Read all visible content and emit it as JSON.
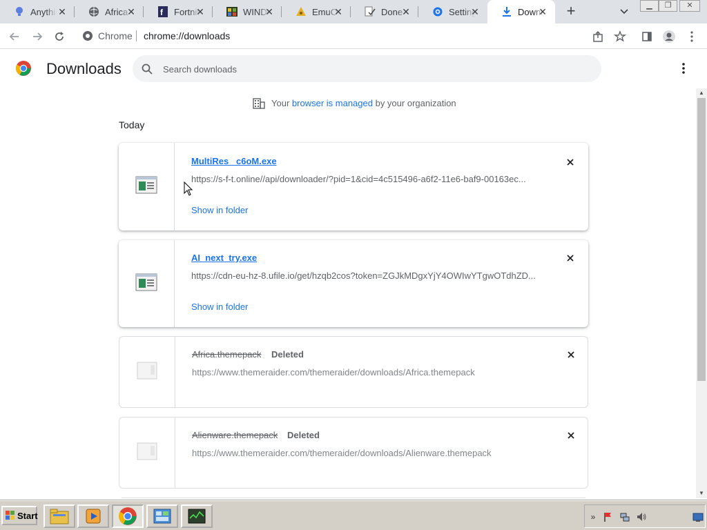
{
  "tabs": [
    {
      "title": "Anything",
      "icon": "bulb-icon",
      "active": false
    },
    {
      "title": "Africa",
      "icon": "globe-icon",
      "active": false
    },
    {
      "title": "Fortnite",
      "icon": "f-logo-icon",
      "active": false
    },
    {
      "title": "WINDOWS",
      "icon": "windows-logo-icon",
      "active": false
    },
    {
      "title": "EmuOS",
      "icon": "emu-icon",
      "active": false
    },
    {
      "title": "Done",
      "icon": "doc-check-icon",
      "active": false
    },
    {
      "title": "Settings",
      "icon": "gear-icon",
      "active": false
    },
    {
      "title": "Downloads",
      "icon": "download-icon",
      "active": true
    }
  ],
  "toolbar": {
    "site_label": "Chrome",
    "url": "chrome://downloads"
  },
  "header": {
    "title": "Downloads",
    "search_placeholder": "Search downloads"
  },
  "managed_notice": {
    "prefix": "Your",
    "link": "browser is managed",
    "suffix": "by your organization"
  },
  "section_label": "Today",
  "downloads": [
    {
      "filename": "MultiRes _c6oM.exe",
      "url": "https://s-f-t.online//api/downloader/?pid=1&cid=4c515496-a6f2-11e6-baf9-00163ec...",
      "action": "Show in folder",
      "status": "",
      "deleted": false
    },
    {
      "filename": "AI_next_try.exe",
      "url": "https://cdn-eu-hz-8.ufile.io/get/hzqb2cos?token=ZGJkMDgxYjY4OWIwYTgwOTdhZD...",
      "action": "Show in folder",
      "status": "",
      "deleted": false
    },
    {
      "filename": "Africa.themepack",
      "url": "https://www.themeraider.com/themeraider/downloads/Africa.themepack",
      "action": "",
      "status": "Deleted",
      "deleted": true
    },
    {
      "filename": "Alienware.themepack",
      "url": "https://www.themeraider.com/themeraider/downloads/Alienware.themepack",
      "action": "",
      "status": "Deleted",
      "deleted": true
    }
  ],
  "taskbar": {
    "start_label": "Start",
    "apps": [
      "file-explorer-icon",
      "media-player-icon",
      "chrome-icon",
      "control-panel-icon",
      "task-manager-icon"
    ]
  },
  "colors": {
    "accent": "#1a73e8",
    "tabstrip": "#dee1e6",
    "taskbar": "#d4d0c8"
  }
}
